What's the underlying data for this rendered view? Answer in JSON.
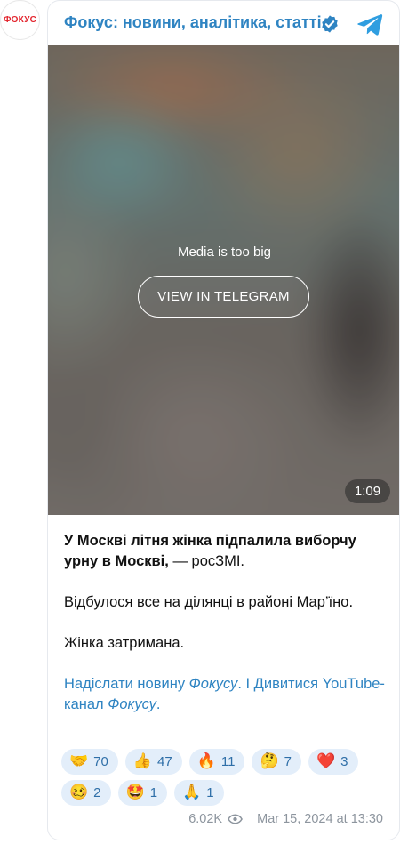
{
  "channel": {
    "avatar_text": "ФОКУС",
    "title": "Фокус: новини, аналітика, статті",
    "verified_icon": "verified-badge-icon",
    "telegram_icon": "telegram-icon",
    "accent_color": "#2f84c2"
  },
  "media": {
    "note": "Media is too big",
    "view_button": "VIEW IN TELEGRAM",
    "duration": "1:09"
  },
  "post": {
    "headline_bold": "У Москві літня жінка підпалила виборчу урну в Москві,",
    "headline_rest": " — росЗМІ.",
    "paragraph_2": "Відбулося все на ділянці в районі Мар’їно.",
    "paragraph_3": "Жінка затримана.",
    "link_1_a": "Надіслати новину ",
    "link_1_b": "Фокусу",
    "link_1_c": ".",
    "separator": " І ",
    "link_2_a": "Дивитися YouTube-канал ",
    "link_2_b": "Фокусу",
    "link_2_c": "."
  },
  "reactions": [
    {
      "emoji": "🤝",
      "count": "70"
    },
    {
      "emoji": "👍",
      "count": "47"
    },
    {
      "emoji": "🔥",
      "count": "11"
    },
    {
      "emoji": "🤔",
      "count": "7"
    },
    {
      "emoji": "❤️",
      "count": "3"
    },
    {
      "emoji": "🥴",
      "count": "2"
    },
    {
      "emoji": "🤩",
      "count": "1"
    },
    {
      "emoji": "🙏",
      "count": "1"
    }
  ],
  "meta": {
    "views": "6.02K",
    "views_icon": "eye-icon",
    "date": "Mar 15, 2024 at 13:30"
  }
}
